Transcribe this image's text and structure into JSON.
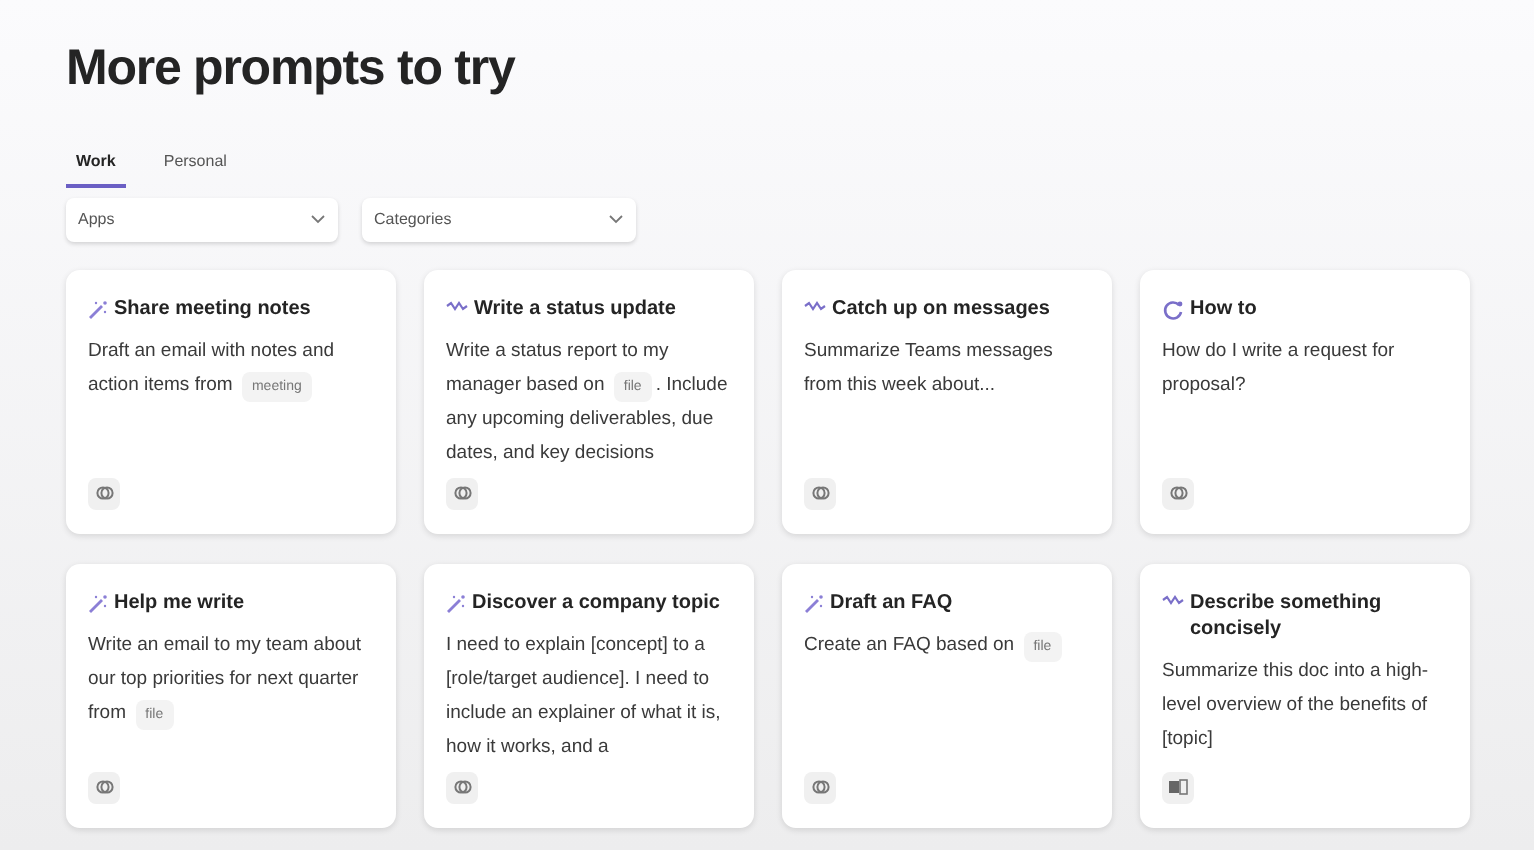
{
  "title": "More prompts to try",
  "tabs": [
    {
      "label": "Work",
      "selected": true
    },
    {
      "label": "Personal",
      "selected": false
    }
  ],
  "filters": [
    {
      "label": "Apps"
    },
    {
      "label": "Categories"
    }
  ],
  "cards": [
    {
      "kind": "wand",
      "title": "Share meeting notes",
      "body": [
        {
          "kind": "text",
          "text": "Draft an email with notes and action items from "
        },
        {
          "kind": "chip",
          "text": "meeting"
        }
      ],
      "app_icon": {
        "kind": "loop"
      }
    },
    {
      "kind": "wave",
      "title": "Write a status update",
      "body": [
        {
          "kind": "text",
          "text": "Write a status report to my manager based on "
        },
        {
          "kind": "chip",
          "text": "file"
        },
        {
          "kind": "text",
          "text": ". Include any upcoming deliverables, due dates, and key decisions"
        }
      ],
      "app_icon": {
        "kind": "loop"
      }
    },
    {
      "kind": "wave",
      "title": "Catch up on messages",
      "body": [
        {
          "kind": "text",
          "text": "Summarize Teams messages from this week about..."
        }
      ],
      "app_icon": {
        "kind": "loop"
      }
    },
    {
      "kind": "spark",
      "title": "How to",
      "body": [
        {
          "kind": "text",
          "text": "How do I write a request for proposal?"
        }
      ],
      "app_icon": {
        "kind": "loop"
      }
    },
    {
      "kind": "wand",
      "title": "Help me write",
      "body": [
        {
          "kind": "text",
          "text": "Write an email to my team about our top priorities for next quarter from "
        },
        {
          "kind": "chip",
          "text": "file"
        }
      ],
      "app_icon": {
        "kind": "loop"
      }
    },
    {
      "kind": "wand",
      "title": "Discover a company topic",
      "body": [
        {
          "kind": "text",
          "text": "I need to explain [concept] to a [role/target audience]. I need to include an explainer of what it is, how it works, and a"
        }
      ],
      "app_icon": {
        "kind": "loop"
      }
    },
    {
      "kind": "wand",
      "title": "Draft an FAQ",
      "body": [
        {
          "kind": "text",
          "text": "Create an FAQ based on "
        },
        {
          "kind": "chip",
          "text": "file"
        }
      ],
      "app_icon": {
        "kind": "loop"
      }
    },
    {
      "kind": "wave",
      "title": "Describe something concisely",
      "body": [
        {
          "kind": "text",
          "text": "Summarize this doc into a high-level overview of the benefits of [topic]"
        }
      ],
      "app_icon": {
        "kind": "doc"
      }
    }
  ]
}
